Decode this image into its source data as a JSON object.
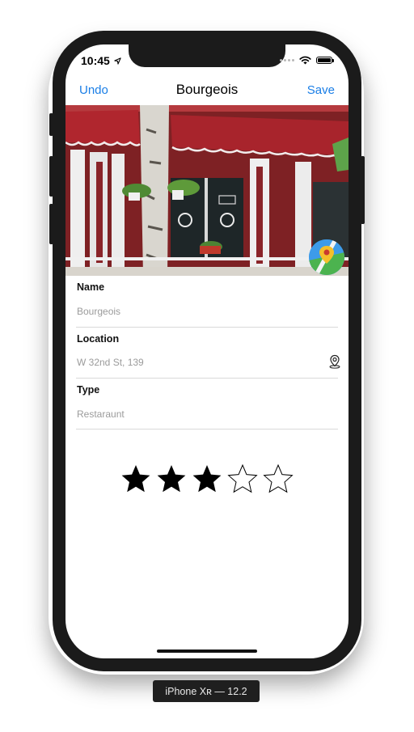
{
  "status_bar": {
    "time": "10:45"
  },
  "navbar": {
    "undo_label": "Undo",
    "title": "Bourgeois",
    "save_label": "Save"
  },
  "fields": {
    "name": {
      "label": "Name",
      "value": "Bourgeois"
    },
    "location": {
      "label": "Location",
      "value": "W 32nd St, 139"
    },
    "type": {
      "label": "Type",
      "value": "Restaraunt"
    }
  },
  "rating": {
    "value": 3,
    "max": 5
  },
  "device_caption": "iPhone Xʀ — 12.2",
  "icons": {
    "location_arrow": "location-arrow-icon",
    "wifi": "wifi-icon",
    "battery": "battery-icon",
    "map": "map-icon",
    "pin": "map-pin-icon",
    "star": "star-icon"
  },
  "colors": {
    "accent": "#1a7ee6",
    "placeholder": "#9b9b9b",
    "separator": "#d9d9d9",
    "device": "#1b1b1b"
  }
}
